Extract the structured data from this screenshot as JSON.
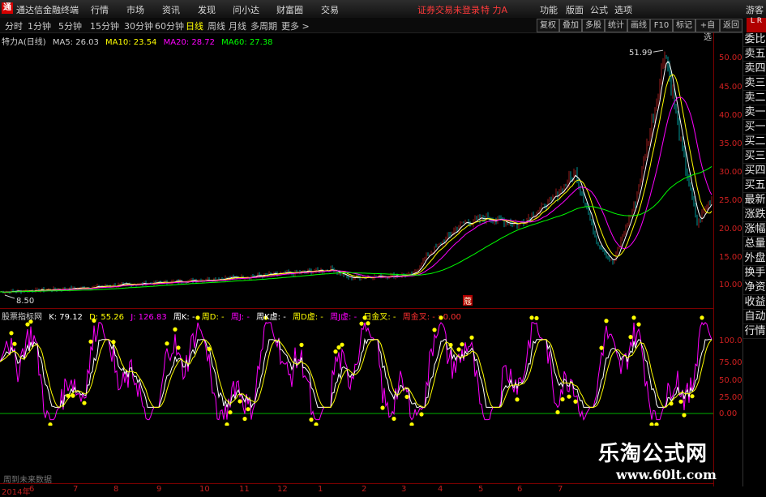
{
  "menubar": {
    "app_title": "通达信金融终端",
    "menus": [
      "行情",
      "市场",
      "资讯",
      "发现",
      "问小达",
      "财富圈",
      "交易"
    ],
    "warning": "证券交易未登录",
    "stock": "特 力A",
    "right": [
      "功能",
      "版面",
      "公式",
      "选项"
    ],
    "guest": "游客"
  },
  "toolbar": {
    "periods": [
      "分时",
      "1分钟",
      "5分钟",
      "15分钟",
      "30分钟",
      "60分钟",
      "日线",
      "周线",
      "月线",
      "多周期",
      "更多 >"
    ],
    "selected_period": "日线",
    "buttons": [
      "复权",
      "叠加",
      "多股",
      "统计",
      "画线",
      "F10",
      "标记",
      "+自选",
      "返回"
    ],
    "corner": "L R"
  },
  "main_legend": {
    "name": "特力A(日线)",
    "ma5": "MA5: 26.03",
    "ma10": "MA10: 23.54",
    "ma20": "MA20: 28.72",
    "ma60": "MA60: 27.38"
  },
  "ind_legend": {
    "name": "股票指标网",
    "k": "K: 79.12",
    "d": "D: 55.26",
    "j": "J: 126.83",
    "wk": "周K: -",
    "wd": "周D: -",
    "wj": "周J: -",
    "wkv": "周K虚: -",
    "wdv": "周D虚: -",
    "wjv": "周J虚: -",
    "cross": "日金叉: -",
    "wcross": "周金叉: - : 0.00"
  },
  "annotations": {
    "high": "51.99",
    "low": "8.50",
    "marker": "蔻"
  },
  "price_axis": [
    "50.00",
    "45.00",
    "40.00",
    "35.00",
    "30.00",
    "25.00",
    "20.00",
    "15.00",
    "10.00"
  ],
  "ind_axis": [
    "100.0",
    "75.00",
    "50.00",
    "25.00",
    "0.00"
  ],
  "right_panel": [
    "委比",
    "卖五",
    "卖四",
    "卖三",
    "卖二",
    "卖一",
    "买一",
    "买二",
    "买三",
    "买四",
    "买五",
    "最新",
    "涨跌",
    "涨幅",
    "总量",
    "外盘",
    "换手",
    "净资",
    "收益",
    "自动",
    "行情"
  ],
  "status": {
    "no_data": "周到未来数据"
  },
  "xaxis": [
    "2014年",
    "6",
    "7",
    "8",
    "9",
    "10",
    "11",
    "12",
    "1",
    "2",
    "3",
    "4",
    "5",
    "6",
    "7"
  ],
  "watermark": {
    "cn": "乐淘公式网",
    "url": "www.60lt.com"
  },
  "colors": {
    "ma5": "#ffffff",
    "ma10": "#ffff00",
    "ma20": "#ff00ff",
    "ma60": "#00ff00",
    "up": "#ff3030",
    "down": "#00ffff",
    "k": "#ffffff",
    "d": "#ffff00",
    "j": "#ff00ff",
    "dot": "#ffff00"
  }
}
